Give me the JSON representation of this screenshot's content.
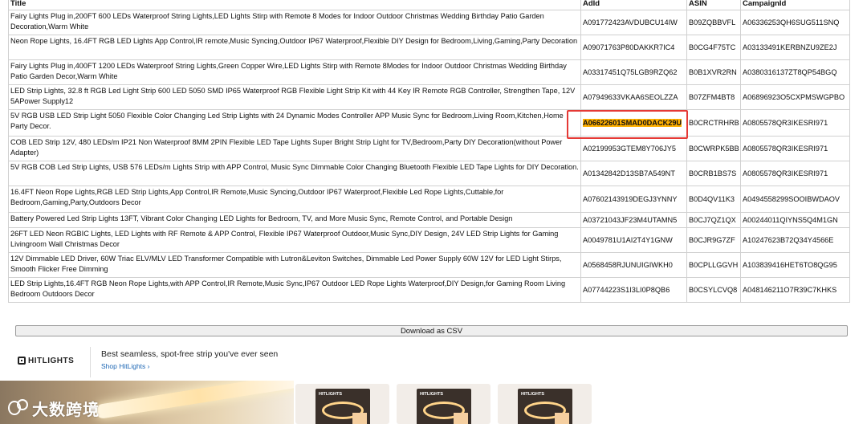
{
  "table": {
    "headers": [
      "Title",
      "AdId",
      "ASIN",
      "CampaignId"
    ],
    "rows": [
      {
        "title": "Fairy Lights Plug in,200FT 600 LEDs Waterproof String Lights,LED Lights Stirp with Remote 8 Modes for Indoor Outdoor Christmas Wedding Birthday Patio Garden Decoration,Warm White",
        "adid": "A091772423AVDUBCU14IW",
        "asin": "B09ZQBBVFL",
        "campaign": "A06336253QH6SUG511SNQ"
      },
      {
        "title": "Neon Rope Lights, 16.4FT RGB LED Lights App Control,IR remote,Music Syncing,Outdoor IP67 Waterproof,Flexible DIY Design for Bedroom,Living,Gaming,Party Decoration",
        "adid": "A09071763P80DAKKR7IC4",
        "asin": "B0CG4F75TC",
        "campaign": "A03133491KERBNZU9ZE2J"
      },
      {
        "title": "Fairy Lights Plug in,400FT 1200 LEDs Waterproof String Lights,Green Copper Wire,LED Lights Stirp with Remote 8Modes for Indoor Outdoor Christmas Wedding Birthday Patio Garden Decor,Warm White",
        "adid": "A03317451Q75LGB9RZQ62",
        "asin": "B0B1XVR2RN",
        "campaign": "A0380316137ZT8QP54BGQ"
      },
      {
        "title": "LED Strip Lights, 32.8 ft RGB Led Light Strip 600 LED 5050 SMD IP65 Waterproof RGB Flexible Light Strip Kit with 44 Key IR Remote RGB Controller, Strengthen Tape, 12V 5APower Supply12",
        "adid": "A07949633VKAA6SEOLZZA",
        "asin": "B07ZFM4BT8",
        "campaign": "A06896923O5CXPMSWGPBO"
      },
      {
        "title": "5V RGB USB LED Strip Light 5050 Flexible Color Changing Led Strip Lights with 24 Dynamic Modes Controller APP Music Sync for Bedroom,Living Room,Kitchen,Home Party Decor.",
        "adid": "A06622601SMAD0DACK29U",
        "asin": "B0CRCTRHRB",
        "campaign": "A0805578QR3IKESRI971",
        "highlight": true
      },
      {
        "title": "COB LED Strip 12V, 480 LEDs/m IP21 Non Waterproof 8MM 2PIN Flexible LED Tape Lights Super Bright Strip Light for TV,Bedroom,Party DIY Decoration(without Power Adapter)",
        "adid": "A02199953GTEM8Y706JY5",
        "asin": "B0CWRPK5BB",
        "campaign": "A0805578QR3IKESRI971"
      },
      {
        "title": "5V RGB COB Led Strip Lights, USB 576 LEDs/m Lights Strip with APP Control, Music Sync Dimmable Color Changing Bluetooth Flexible LED Tape Lights for DIY Decoration.",
        "adid": "A01342842D13SB7A549NT",
        "asin": "B0CRB1BS7S",
        "campaign": "A0805578QR3IKESRI971"
      },
      {
        "title": "16.4FT Neon Rope Lights,RGB LED Strip Lights,App Control,IR Remote,Music Syncing,Outdoor IP67 Waterproof,Flexible Led Rope Lights,Cuttable,for Bedroom,Gaming,Party,Outdoors Decor",
        "adid": "A07602143919DEGJ3YNNY",
        "asin": "B0D4QV11K3",
        "campaign": "A0494558299SOOIBWDAOV"
      },
      {
        "title": "Battery Powered Led Strip Lights 13FT, Vibrant Color Changing LED Lights for Bedroom, TV, and More Music Sync, Remote Control, and Portable Design",
        "adid": "A03721043JF23M4UTAMN5",
        "asin": "B0CJ7QZ1QX",
        "campaign": "A00244011QIYNS5Q4M1GN"
      },
      {
        "title": "26FT LED Neon RGBIC Lights, LED Lights with RF Remote & APP Control, Flexible IP67 Waterproof Outdoor,Music Sync,DIY Design, 24V LED Strip Lights for Gaming Livingroom Wall Christmas Decor",
        "adid": "A0049781U1AI2T4Y1GNW",
        "asin": "B0CJR9G7ZF",
        "campaign": "A10247623B72Q34Y4566E"
      },
      {
        "title": "12V Dimmable LED Driver, 60W Triac ELV/MLV LED Transformer Compatible with Lutron&Leviton Switches, Dimmable Led Power Supply 60W 12V for LED Light Stirps, Smooth Flicker Free Dimming",
        "adid": "A0568458RJUNUIGIWKH0",
        "asin": "B0CPLLGGVH",
        "campaign": "A103839416HET6TO8QG95"
      },
      {
        "title": "LED Strip Lights,16.4FT RGB Neon Rope Lights,with APP Control,IR Remote,Music Sync,IP67 Outdoor LED Rope Lights Waterproof,DIY Design,for Gaming Room Living Bedroom Outdoors Decor",
        "adid": "A07744223S1I3LI0P8QB6",
        "asin": "B0CSYLCVQ8",
        "campaign": "A048146211O7R39C7KHKS"
      }
    ]
  },
  "csv_button": {
    "label": "Download as CSV"
  },
  "sponsored": {
    "brand_logo": "HITLIGHTS",
    "headline": "Best seamless, spot-free strip you've ever seen",
    "link": "Shop HitLights ›"
  },
  "watermark": {
    "text": "大数跨境",
    "icon": "logo-icon"
  },
  "colors": {
    "highlight": "#ffb000",
    "annotation_box": "#e53935",
    "link": "#1e67b4"
  }
}
